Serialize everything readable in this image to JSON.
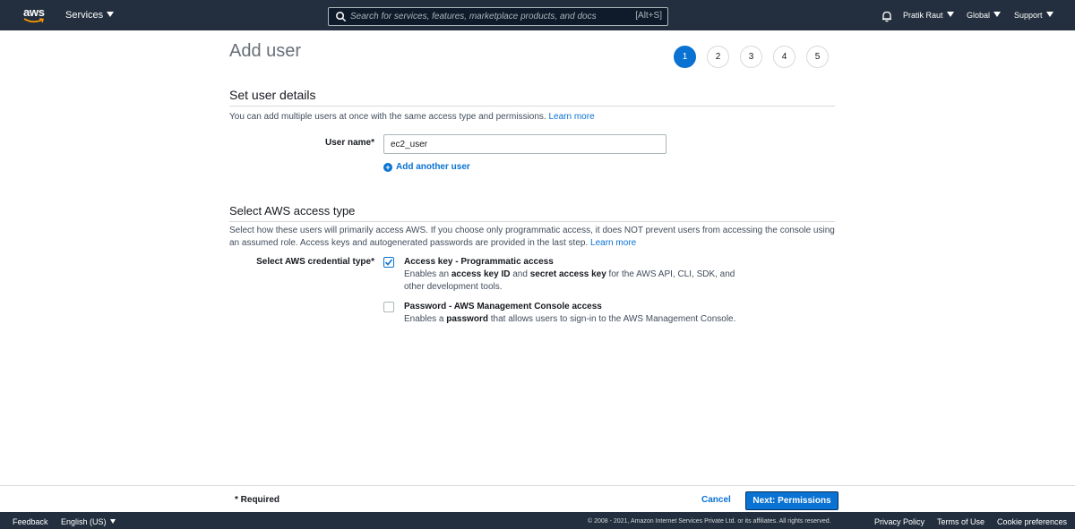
{
  "topnav": {
    "logo_text": "aws",
    "services_label": "Services",
    "search_placeholder": "Search for services, features, marketplace products, and docs",
    "search_shortcut": "[Alt+S]",
    "user_label": "Pratik Raut",
    "region_label": "Global",
    "support_label": "Support",
    "colors": {
      "bg": "#232f3e",
      "accent": "#ff9900"
    }
  },
  "page": {
    "title": "Add user",
    "steps": [
      "1",
      "2",
      "3",
      "4",
      "5"
    ],
    "active_step": "1"
  },
  "user_details": {
    "heading": "Set user details",
    "description": "You can add multiple users at once with the same access type and permissions.",
    "learn_more": "Learn more",
    "username_label": "User name*",
    "username_value": "ec2_user",
    "add_another": "Add another user"
  },
  "access_type": {
    "heading": "Select AWS access type",
    "description": "Select how these users will primarily access AWS. If you choose only programmatic access, it does NOT prevent users from accessing the console using an assumed role. Access keys and autogenerated passwords are provided in the last step.",
    "learn_more": "Learn more",
    "credential_label": "Select AWS credential type*",
    "options": [
      {
        "title": "Access key - Programmatic access",
        "desc_1": "Enables an ",
        "desc_b1": "access key ID",
        "desc_2": " and ",
        "desc_b2": "secret access key",
        "desc_3": " for the AWS API, CLI, SDK, and other development tools.",
        "checked": true
      },
      {
        "title": "Password - AWS Management Console access",
        "desc_1": "Enables a ",
        "desc_b1": "password",
        "desc_2": " that allows users to sign-in to the AWS Management Console.",
        "checked": false
      }
    ]
  },
  "actions": {
    "required_note": "* Required",
    "cancel": "Cancel",
    "next": "Next: Permissions",
    "primary_color": "#0972d3"
  },
  "footer": {
    "feedback": "Feedback",
    "language": "English (US)",
    "copyright": "© 2008 - 2021, Amazon Internet Services Private Ltd. or its affiliates. All rights reserved.",
    "privacy": "Privacy Policy",
    "terms": "Terms of Use",
    "cookies": "Cookie preferences"
  }
}
